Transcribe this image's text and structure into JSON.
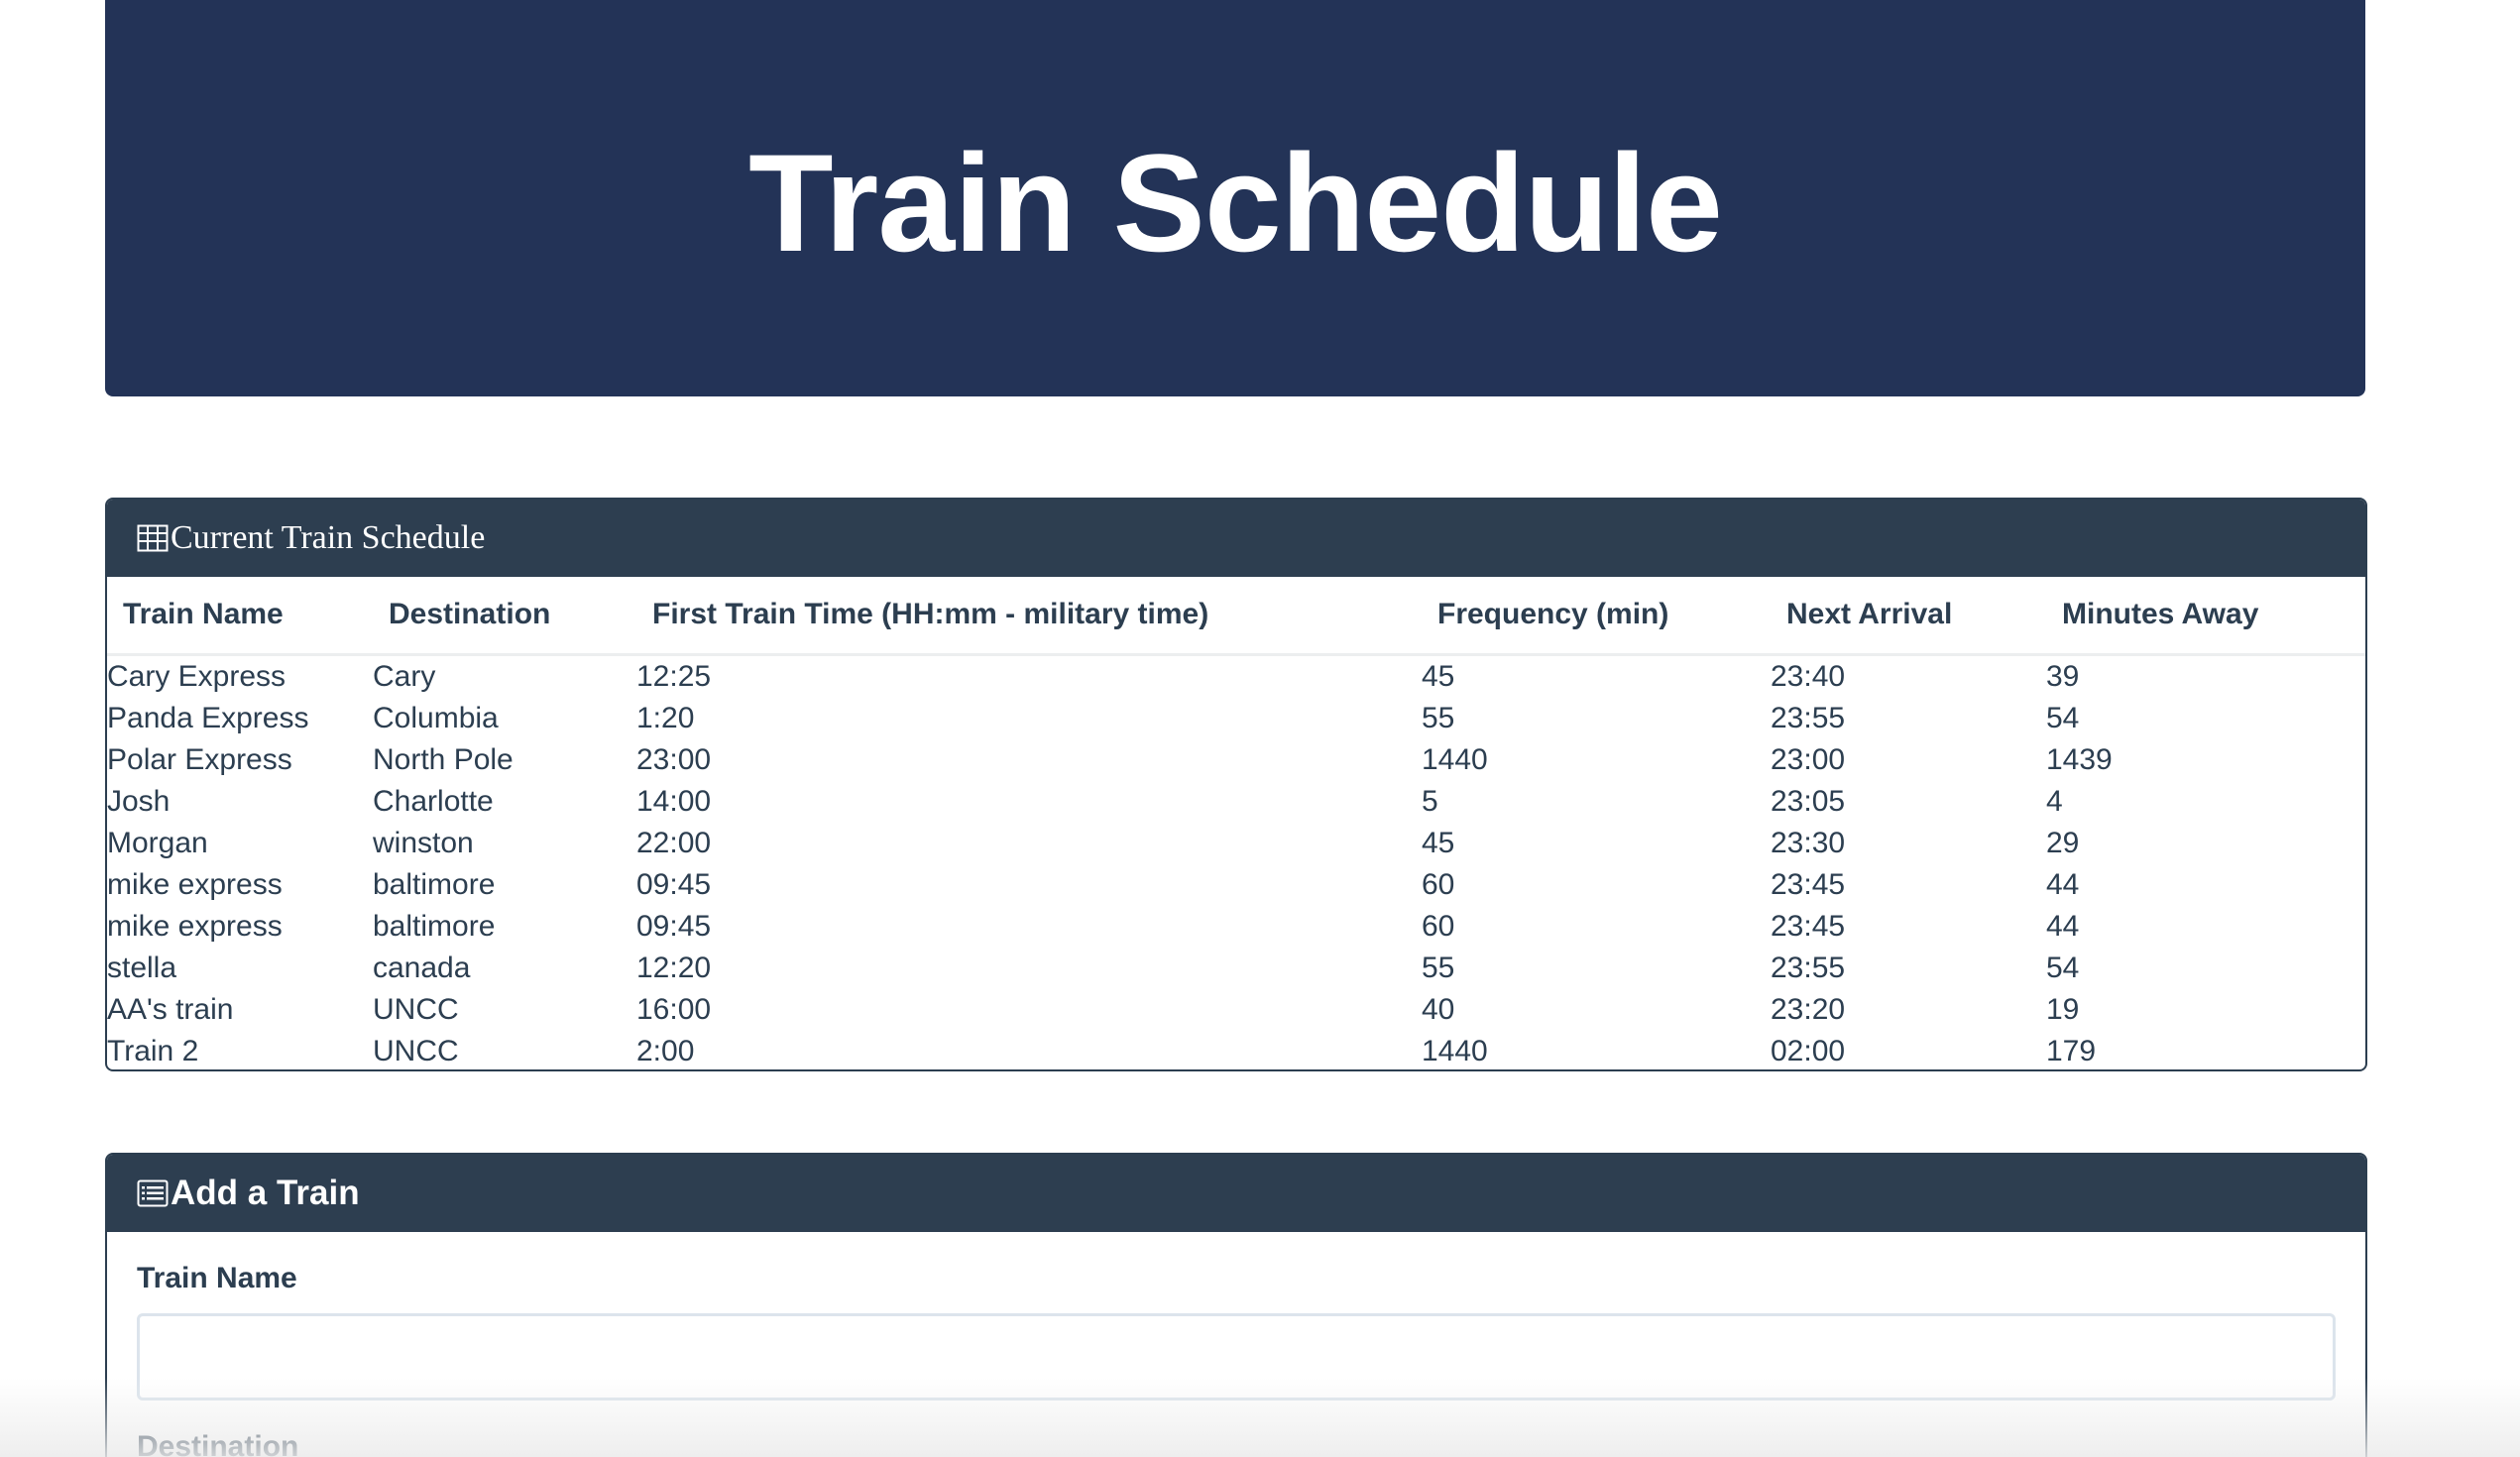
{
  "header": {
    "title": "Train Schedule"
  },
  "schedule": {
    "heading": "Current Train Schedule",
    "heading_icon": "table-icon",
    "columns": [
      "Train Name",
      "Destination",
      "First Train Time (HH:mm - military time)",
      "Frequency (min)",
      "Next Arrival",
      "Minutes Away"
    ],
    "rows": [
      [
        "Cary Express",
        "Cary",
        "12:25",
        "45",
        "23:40",
        "39"
      ],
      [
        "Panda Express",
        "Columbia",
        "1:20",
        "55",
        "23:55",
        "54"
      ],
      [
        "Polar Express",
        "North Pole",
        "23:00",
        "1440",
        "23:00",
        "1439"
      ],
      [
        "Josh",
        "Charlotte",
        "14:00",
        "5",
        "23:05",
        "4"
      ],
      [
        "Morgan",
        "winston",
        "22:00",
        "45",
        "23:30",
        "29"
      ],
      [
        "mike express",
        "baltimore",
        "09:45",
        "60",
        "23:45",
        "44"
      ],
      [
        "mike express",
        "baltimore",
        "09:45",
        "60",
        "23:45",
        "44"
      ],
      [
        "stella",
        "canada",
        "12:20",
        "55",
        "23:55",
        "54"
      ],
      [
        "AA's train",
        "UNCC",
        "16:00",
        "40",
        "23:20",
        "19"
      ],
      [
        "Train 2",
        "UNCC",
        "2:00",
        "1440",
        "02:00",
        "179"
      ]
    ]
  },
  "add_train": {
    "heading": "Add a Train",
    "heading_icon": "list-alt-icon",
    "train_name_label": "Train Name",
    "train_name_value": "",
    "destination_label": "Destination"
  },
  "colors": {
    "jumbotron": "#233357",
    "panel_heading": "#2d3e50",
    "text": "#2c3e50"
  }
}
